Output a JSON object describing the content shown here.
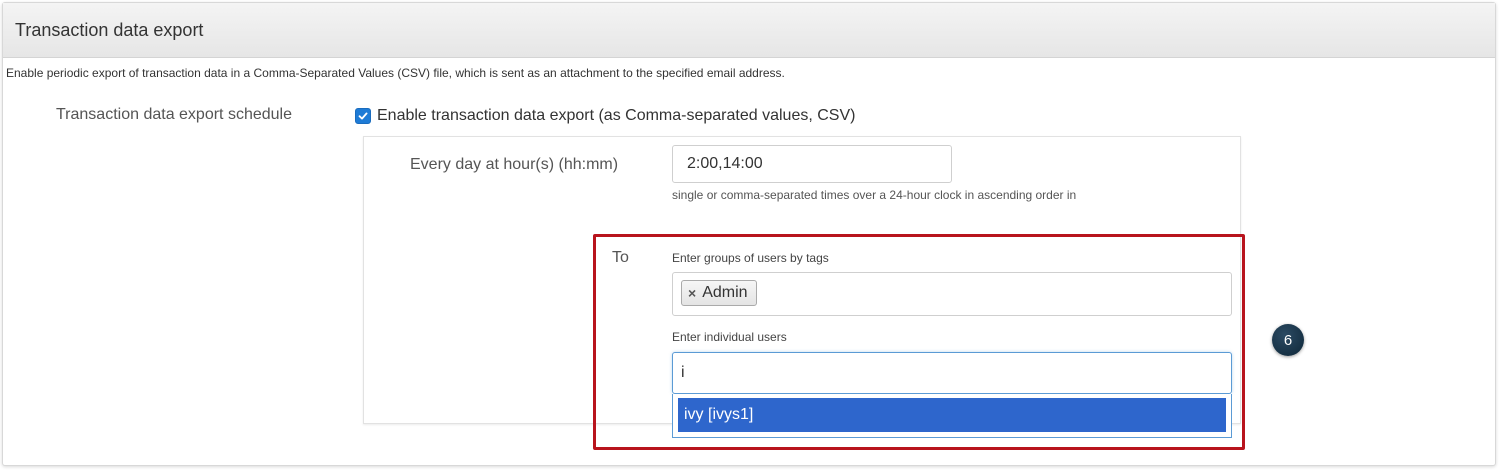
{
  "panel": {
    "title": "Transaction data export",
    "description": "Enable periodic export of transaction data in a Comma-Separated Values (CSV) file, which is sent as an attachment to the specified email address."
  },
  "schedule": {
    "label": "Transaction data export schedule",
    "enable_checked": true,
    "enable_label": "Enable transaction data export (as Comma-separated values, CSV)"
  },
  "hours": {
    "label": "Every day at hour(s) (hh:mm)",
    "value": "2:00,14:00",
    "help": "single or comma-separated times over a 24-hour clock in ascending order in"
  },
  "recipients": {
    "to_label": "To",
    "tags_label": "Enter groups of users by tags",
    "tags": [
      {
        "remove_symbol": "×",
        "label": "Admin"
      }
    ],
    "users_label": "Enter individual users",
    "users_value": "i",
    "suggestions": [
      "ivy [ivys1]"
    ]
  },
  "callout": {
    "number": "6"
  },
  "colors": {
    "highlight_border": "#b8141d",
    "checkbox": "#1e7bd6",
    "selected_option": "#2e66cc",
    "callout_bg": "#0e2738"
  }
}
